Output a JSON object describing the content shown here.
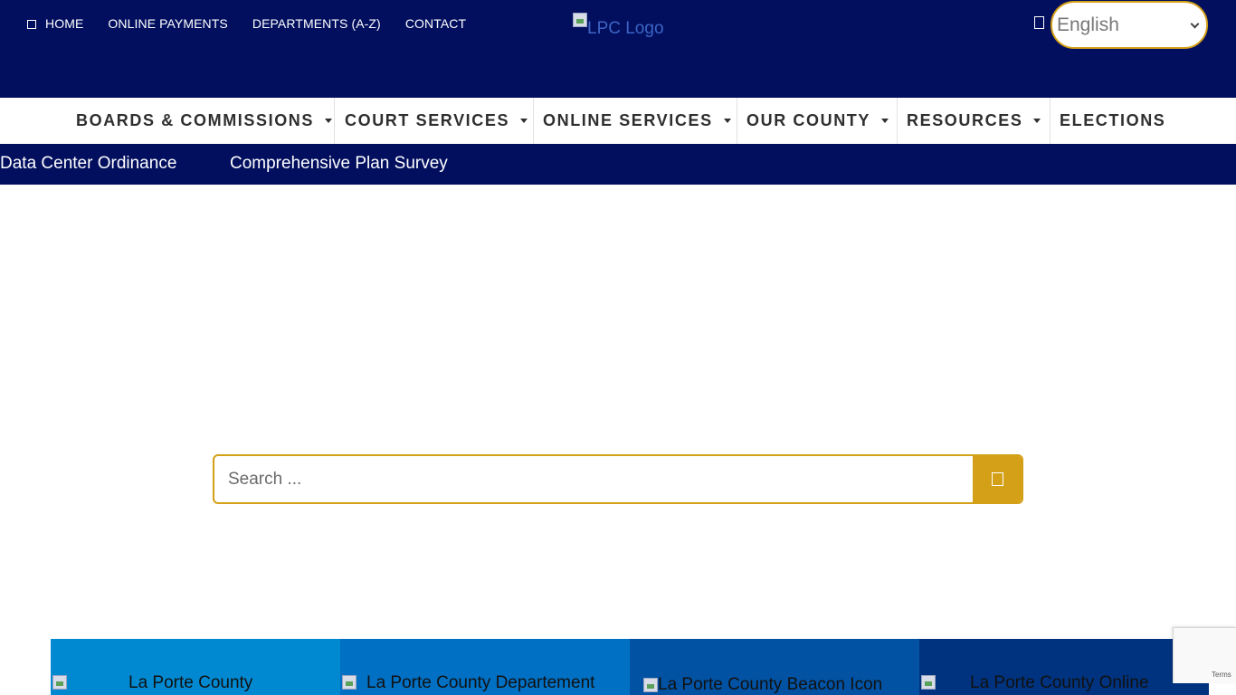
{
  "top_nav": {
    "home": "HOME",
    "online_payments": "ONLINE PAYMENTS",
    "departments": "DEPARTMENTS (A-Z)",
    "contact": "CONTACT"
  },
  "logo": {
    "alt": "LPC Logo"
  },
  "language": {
    "selected": "English"
  },
  "main_nav": [
    {
      "label": "BOARDS & COMMISSIONS",
      "has_dropdown": true
    },
    {
      "label": "COURT SERVICES",
      "has_dropdown": true
    },
    {
      "label": "ONLINE SERVICES",
      "has_dropdown": true
    },
    {
      "label": "OUR COUNTY",
      "has_dropdown": true
    },
    {
      "label": "RESOURCES",
      "has_dropdown": true
    },
    {
      "label": "ELECTIONS",
      "has_dropdown": false
    }
  ],
  "announcements": [
    "Data Center Ordinance",
    "Comprehensive Plan Survey"
  ],
  "search": {
    "placeholder": "Search ..."
  },
  "tiles": [
    {
      "text": "La Porte County",
      "color": "#0089d1"
    },
    {
      "text": "La Porte County Departement",
      "color": "#0070c4"
    },
    {
      "text": "La Porte County Beacon Icon",
      "color": "#0152a3"
    },
    {
      "text": "La Porte County Online",
      "color": "#00337f"
    }
  ],
  "recaptcha": {
    "terms": "Terms"
  },
  "colors": {
    "navy": "#020f5e",
    "gold": "#d4a017"
  }
}
